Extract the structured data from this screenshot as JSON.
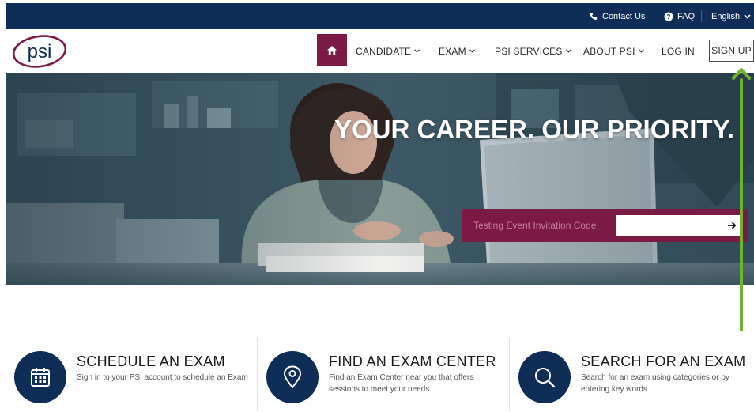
{
  "topbar": {
    "contact": "Contact Us",
    "faq": "FAQ",
    "language": "English"
  },
  "nav": {
    "logo_text": "psi",
    "items": [
      "CANDIDATE",
      "EXAM",
      "PSI SERVICES",
      "ABOUT PSI"
    ],
    "login": "LOG IN",
    "signup": "SIGN UP"
  },
  "hero": {
    "title": "YOUR CAREER. OUR PRIORITY.",
    "invitation_label": "Testing Event Invitation Code",
    "invitation_value": ""
  },
  "cards": [
    {
      "title": "SCHEDULE AN EXAM",
      "desc": "Sign in to your PSI account to schedule an Exam",
      "icon": "calendar-icon"
    },
    {
      "title": "FIND AN EXAM CENTER",
      "desc": "Find an Exam Center near you that offers sessions to meet your needs",
      "icon": "map-pin-icon"
    },
    {
      "title": "SEARCH FOR AN EXAM",
      "desc": "Search for an exam using categories or by entering key words",
      "icon": "search-icon"
    }
  ],
  "colors": {
    "navy": "#0e2d57",
    "maroon": "#7b1a44",
    "annotation_green": "#6fb22e"
  }
}
